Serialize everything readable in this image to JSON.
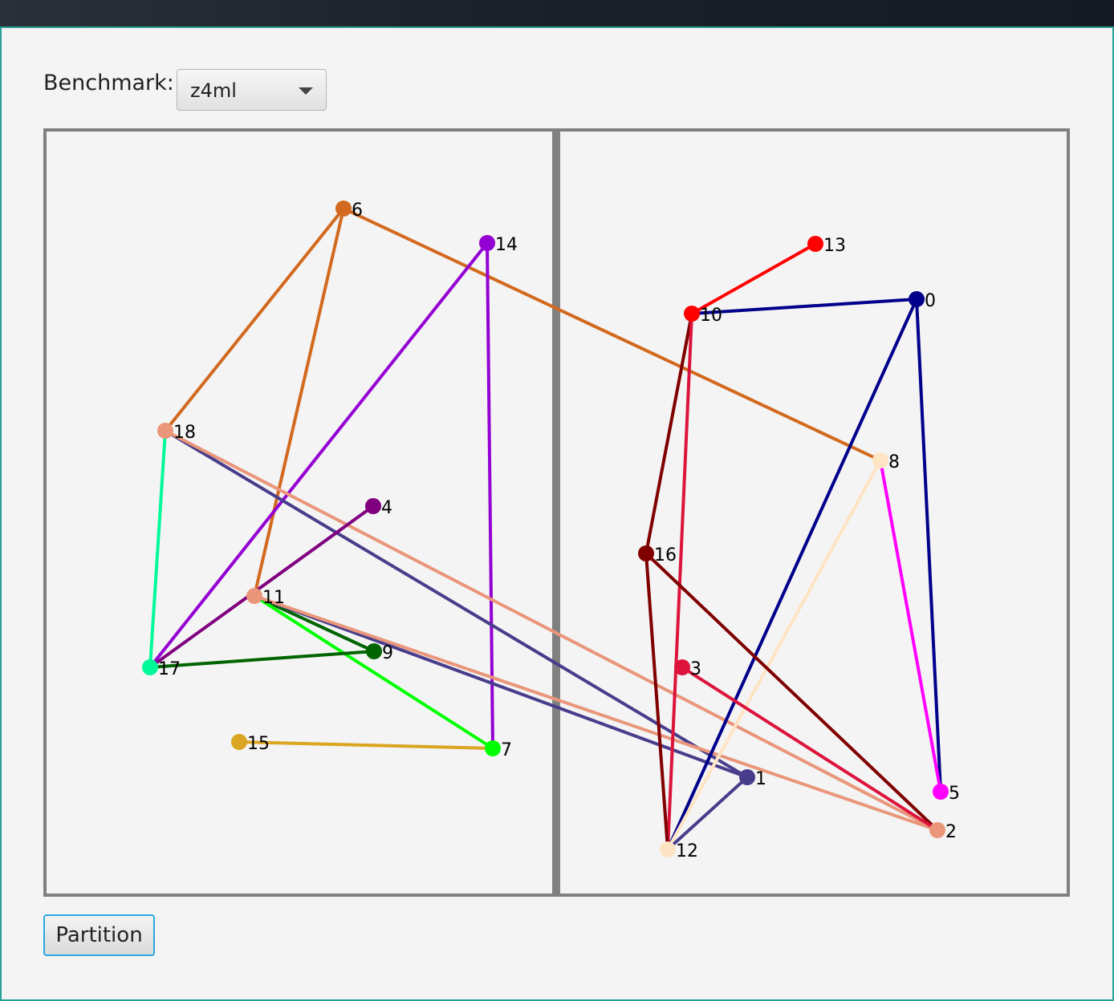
{
  "benchmark": {
    "label": "Benchmark:",
    "selected": "z4ml"
  },
  "partition_button": "Partition",
  "graph": {
    "nodes": [
      {
        "id": "0",
        "color": "#00008b"
      },
      {
        "id": "1",
        "color": "#483d8b"
      },
      {
        "id": "2",
        "color": "#e9967a"
      },
      {
        "id": "3",
        "color": "#dc143c"
      },
      {
        "id": "4",
        "color": "#800080"
      },
      {
        "id": "5",
        "color": "#ff00ff"
      },
      {
        "id": "6",
        "color": "#d2691e"
      },
      {
        "id": "7",
        "color": "#00ff00"
      },
      {
        "id": "8",
        "color": "#ffe4c4"
      },
      {
        "id": "9",
        "color": "#006400"
      },
      {
        "id": "10",
        "color": "#ff0000"
      },
      {
        "id": "11",
        "color": "#e9967a"
      },
      {
        "id": "12",
        "color": "#ffe4c4"
      },
      {
        "id": "13",
        "color": "#ff0000"
      },
      {
        "id": "14",
        "color": "#9400d3"
      },
      {
        "id": "15",
        "color": "#daa520"
      },
      {
        "id": "16",
        "color": "#800000"
      },
      {
        "id": "17",
        "color": "#00fa9a"
      },
      {
        "id": "18",
        "color": "#e9967a"
      }
    ],
    "edges": [
      {
        "from": "6",
        "to": "18",
        "color": "#d2691e"
      },
      {
        "from": "6",
        "to": "11",
        "color": "#d2691e"
      },
      {
        "from": "6",
        "to": "8",
        "color": "#d2691e"
      },
      {
        "from": "14",
        "to": "17",
        "color": "#9400d3"
      },
      {
        "from": "14",
        "to": "7",
        "color": "#9400d3"
      },
      {
        "from": "18",
        "to": "17",
        "color": "#00fa9a"
      },
      {
        "from": "18",
        "to": "1",
        "color": "#483d8b"
      },
      {
        "from": "18",
        "to": "2",
        "color": "#e9967a"
      },
      {
        "from": "4",
        "to": "17",
        "color": "#800080"
      },
      {
        "from": "11",
        "to": "9",
        "color": "#006400"
      },
      {
        "from": "11",
        "to": "7",
        "color": "#00ff00"
      },
      {
        "from": "11",
        "to": "1",
        "color": "#483d8b"
      },
      {
        "from": "11",
        "to": "2",
        "color": "#e9967a"
      },
      {
        "from": "17",
        "to": "9",
        "color": "#006400"
      },
      {
        "from": "15",
        "to": "7",
        "color": "#daa520"
      },
      {
        "from": "10",
        "to": "13",
        "color": "#ff0000"
      },
      {
        "from": "10",
        "to": "0",
        "color": "#00008b"
      },
      {
        "from": "10",
        "to": "16",
        "color": "#800000"
      },
      {
        "from": "10",
        "to": "12",
        "color": "#dc143c"
      },
      {
        "from": "0",
        "to": "12",
        "color": "#00008b"
      },
      {
        "from": "0",
        "to": "5",
        "color": "#00008b"
      },
      {
        "from": "8",
        "to": "12",
        "color": "#ffe4c4"
      },
      {
        "from": "8",
        "to": "5",
        "color": "#ff00ff"
      },
      {
        "from": "16",
        "to": "12",
        "color": "#800000"
      },
      {
        "from": "16",
        "to": "2",
        "color": "#800000"
      },
      {
        "from": "3",
        "to": "2",
        "color": "#dc143c"
      },
      {
        "from": "12",
        "to": "1",
        "color": "#483d8b"
      }
    ]
  }
}
